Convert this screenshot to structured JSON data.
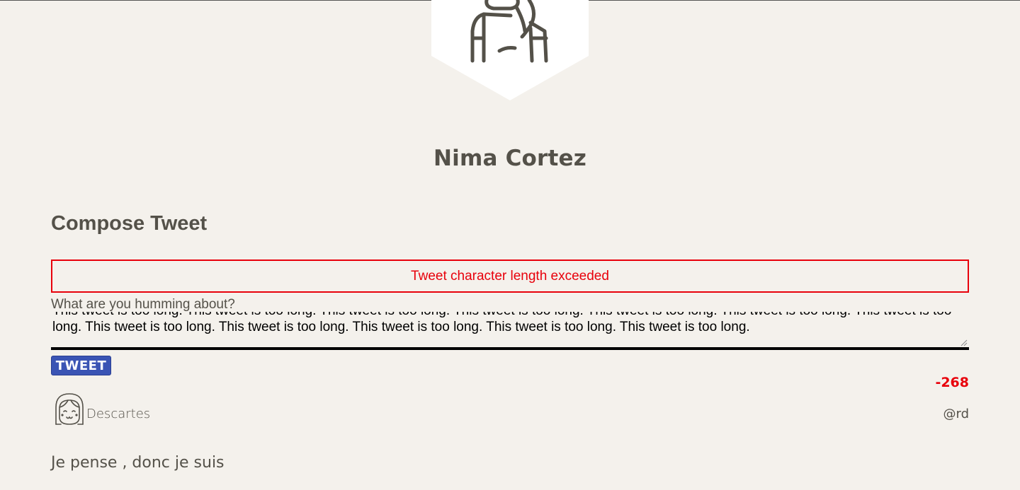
{
  "profile": {
    "name": "Nima Cortez",
    "avatar_icon": "person-back-icon"
  },
  "compose": {
    "title": "Compose Tweet",
    "error_message": "Tweet character length exceeded",
    "label": "What are you humming about?",
    "textarea_value": "This tweet is too long. This tweet is too long. This tweet is too long. This tweet is too long. This tweet is too long. This tweet is too long. This tweet is too long. This tweet is too long. This tweet is too long. This tweet is too long. This tweet is too long. This tweet is too long.",
    "button_label": "TWEET",
    "char_counter": "-268"
  },
  "tweet": {
    "author_name": "Descartes",
    "handle": "@rd",
    "content": "Je pense , donc je suis",
    "avatar_icon": "smiling-face-icon"
  },
  "colors": {
    "background": "#f4f1ec",
    "text": "#545149",
    "error": "#e8000b",
    "button": "#3a54b4"
  }
}
